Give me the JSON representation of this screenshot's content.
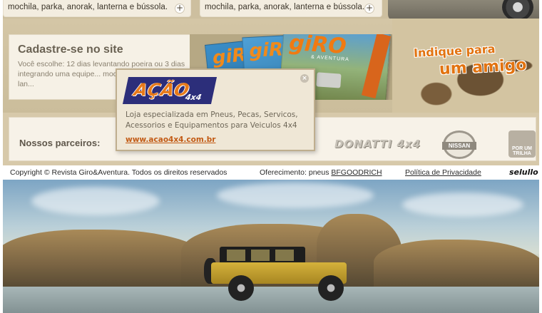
{
  "top_cards": [
    {
      "text": "mochila, parka, anorak, lanterna e bússola."
    },
    {
      "text": "mochila, parka, anorak, lanterna e bússola."
    }
  ],
  "cadastre": {
    "title": "Cadastre-se no site",
    "text": "Você escolhe: 12 dias levantando poeira ou 3 dias integrando uma equipe... mochila, parka, anorak, lan..."
  },
  "magazine": {
    "logo": "giRO",
    "subtitle": "& AVENTURA"
  },
  "indique": {
    "line1": "Indique para",
    "line2": "um amigo"
  },
  "partners": {
    "label": "Nossos parceiros:",
    "logos": [
      "DONATTI 4x4",
      "NISSAN",
      "POR UM TRILHA"
    ]
  },
  "footer": {
    "copyright": "Copyright © Revista Giro&Aventura. Todos os direitos reservados",
    "oferecimento_prefix": "Oferecimento: pneus ",
    "oferecimento_brand": "BFGOODRICH",
    "privacy": "Política de Privacidade",
    "agency": "selullo"
  },
  "popup": {
    "logo_word": "AÇÃO",
    "logo_sub": "4x4",
    "description": "Loja especializada em Pneus, Pecas, Servicos, Acessorios e Equipamentos para Veiculos 4x4",
    "link": "www.acao4x4.com.br",
    "close_icon": "close-icon"
  },
  "colors": {
    "accent_orange": "#e27310",
    "link_orange": "#c25a14",
    "background_sand": "#d7c9aa",
    "logo_navy": "#2c2e7a"
  }
}
